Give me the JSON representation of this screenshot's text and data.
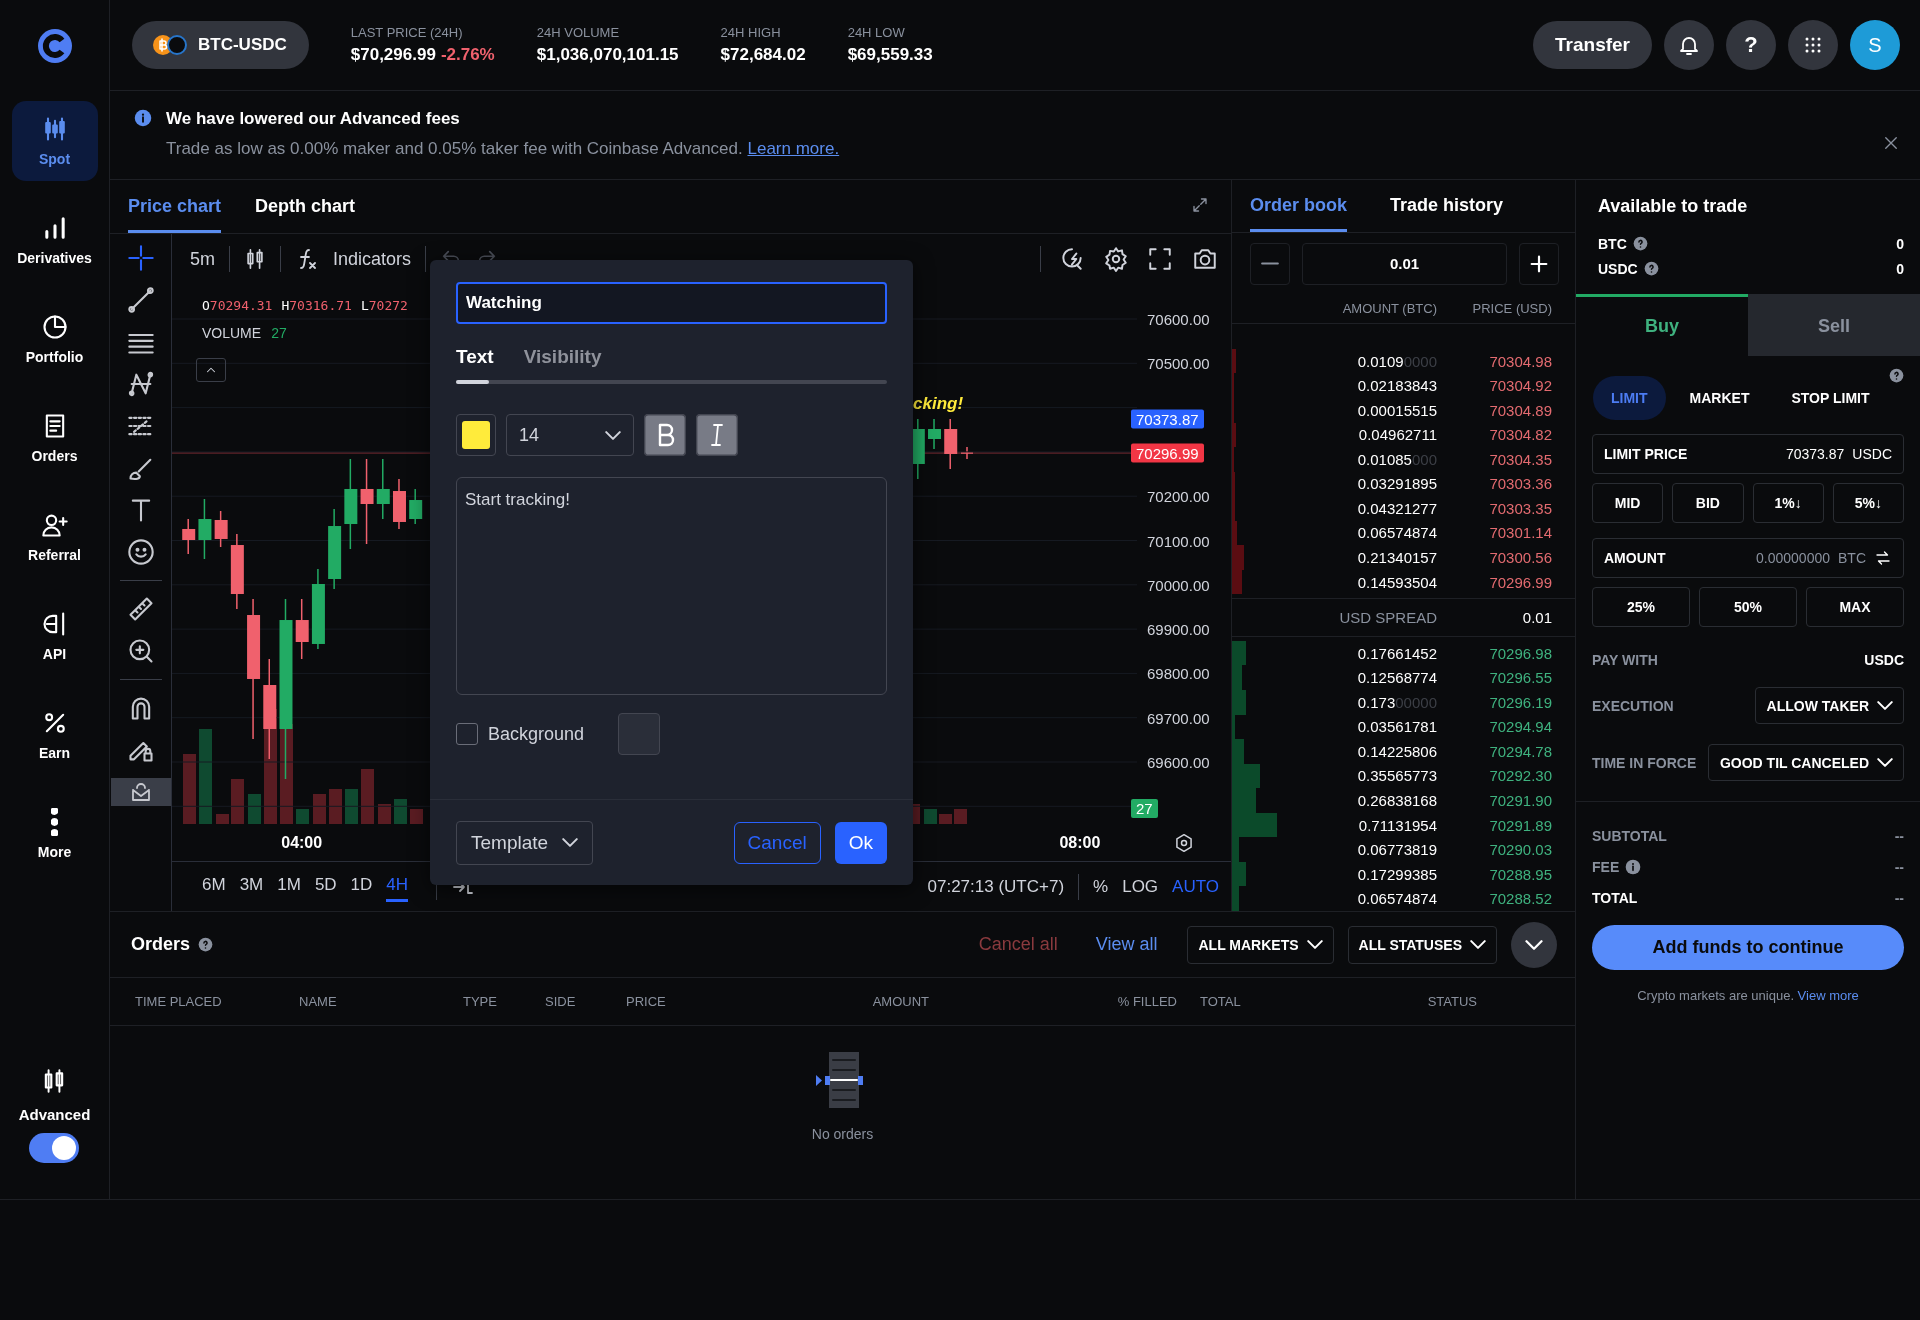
{
  "sidebar": {
    "items": [
      {
        "label": "Spot",
        "selected": true
      },
      {
        "label": "Derivatives",
        "selected": false
      },
      {
        "label": "Portfolio",
        "selected": false
      },
      {
        "label": "Orders",
        "selected": false
      },
      {
        "label": "Referral",
        "selected": false
      },
      {
        "label": "API",
        "selected": false
      },
      {
        "label": "Earn",
        "selected": false
      },
      {
        "label": "More",
        "selected": false
      }
    ],
    "advanced": {
      "label": "Advanced",
      "on": true
    }
  },
  "header": {
    "pair": "BTC-USDC",
    "stats": [
      {
        "label": "LAST PRICE (24H)",
        "value": "$70,296.99",
        "change": "-2.76%"
      },
      {
        "label": "24H VOLUME",
        "value": "$1,036,070,101.15"
      },
      {
        "label": "24H HIGH",
        "value": "$72,684.02"
      },
      {
        "label": "24H LOW",
        "value": "$69,559.33"
      }
    ],
    "transfer": "Transfer",
    "help": "?",
    "avatar": "S"
  },
  "banner": {
    "title": "We have lowered our Advanced fees",
    "text": "Trade as low as 0.00% maker and 0.05% taker fee with Coinbase Advanced.",
    "link": "Learn more."
  },
  "chart": {
    "tabs": [
      {
        "label": "Price chart",
        "selected": true
      },
      {
        "label": "Depth chart",
        "selected": false
      }
    ],
    "interval": "5m",
    "indicators": "Indicators",
    "ohlc": [
      {
        "key": "O",
        "value": "70294.31"
      },
      {
        "key": "H",
        "value": "70316.71"
      },
      {
        "key": "L",
        "value": "70272"
      }
    ],
    "volume_label": "VOLUME",
    "volume_value": "27",
    "annotation": "cking!",
    "price_markers": [
      {
        "label": "70373.87",
        "color": "#2962ff"
      },
      {
        "label": "70296.99",
        "color": "#f23645"
      }
    ],
    "volume_marker": {
      "label": "27",
      "color": "#22ab64"
    },
    "chart_data": {
      "type": "candlestick",
      "x": [
        205,
        210,
        215,
        220,
        225,
        230,
        235,
        240,
        245,
        250,
        255,
        260,
        265,
        270,
        275,
        430,
        435,
        440
      ],
      "ohlc": [
        [
          70126.0,
          70148.5,
          70069.5,
          70101.1
        ],
        [
          70101.1,
          70193.7,
          70058.2,
          70148.5
        ],
        [
          70146.3,
          70166.6,
          70085.3,
          70103.4
        ],
        [
          70089.8,
          70114.7,
          69945.4,
          69979.2
        ],
        [
          69931.8,
          69967.9,
          69651.9,
          69787.4
        ],
        [
          69773.8,
          69832.5,
          69606.8,
          69674.5
        ],
        [
          69674.5,
          69967.9,
          69561.6,
          69920.5
        ],
        [
          69920.5,
          69967.9,
          69832.5,
          69870.9
        ],
        [
          69866.4,
          70035.7,
          69855.1,
          70001.8
        ],
        [
          70013.1,
          70171.1,
          69990.5,
          70132.7
        ],
        [
          70137.2,
          70284.0,
          70080.8,
          70216.3
        ],
        [
          70216.3,
          70284.0,
          70092.1,
          70182.4
        ],
        [
          70182.4,
          70284.0,
          70148.5,
          70216.3
        ],
        [
          70211.7,
          70238.8,
          70126.0,
          70141.8
        ],
        [
          70148.5,
          70216.3,
          70137.2,
          70191.4
        ],
        [
          70272.7,
          70374.3,
          70238.8,
          70351.7
        ],
        [
          70329.1,
          70374.3,
          70306.5,
          70351.7
        ],
        [
          70351.7,
          70374.3,
          70261.4,
          70295.3
        ]
      ],
      "xlim": [
        200,
        497.6
      ],
      "ylim": [
        69600,
        70600
      ],
      "grid": true,
      "yticks": [
        {
          "value": 70600,
          "label": "70600.00"
        },
        {
          "value": 70500,
          "label": "70500.00"
        },
        {
          "value": 70200,
          "label": "70200.00"
        },
        {
          "value": 70100,
          "label": "70100.00"
        },
        {
          "value": 70000,
          "label": "70000.00"
        },
        {
          "value": 69900,
          "label": "69900.00"
        },
        {
          "value": 69800,
          "label": "69800.00"
        },
        {
          "value": 69700,
          "label": "69700.00"
        },
        {
          "value": 69600,
          "label": "69600.00"
        }
      ],
      "xticks": [
        {
          "value": 240,
          "label": "04:00"
        },
        {
          "value": 480,
          "label": "08:00"
        }
      ]
    },
    "ranges": [
      {
        "label": "6M",
        "selected": false
      },
      {
        "label": "3M",
        "selected": false
      },
      {
        "label": "1M",
        "selected": false
      },
      {
        "label": "5D",
        "selected": false
      },
      {
        "label": "1D",
        "selected": false
      },
      {
        "label": "4H",
        "selected": true
      }
    ],
    "clock": "07:27:13 (UTC+7)",
    "scale_options": [
      {
        "label": "%",
        "selected": false
      },
      {
        "label": "LOG",
        "selected": false
      },
      {
        "label": "AUTO",
        "selected": true
      }
    ]
  },
  "dialog": {
    "name_value": "Watching",
    "tabs": [
      {
        "label": "Text",
        "selected": true
      },
      {
        "label": "Visibility",
        "selected": false
      }
    ],
    "style": {
      "color": "#ffeb3b",
      "font_size": "14",
      "bold": true,
      "italic": true
    },
    "text": "Start tracking!",
    "background": {
      "label": "Background",
      "checked": false
    },
    "template": "Template",
    "cancel": "Cancel",
    "ok": "Ok"
  },
  "order_book": {
    "tabs": [
      {
        "label": "Order book",
        "selected": true
      },
      {
        "label": "Trade history",
        "selected": false
      }
    ],
    "step": "0.01",
    "columns": [
      "AMOUNT (BTC)",
      "PRICE (USD)"
    ],
    "asks": [
      {
        "amount": "0.0109",
        "pad": "0000",
        "price": "70304.98"
      },
      {
        "amount": "0.02183843",
        "price": "70304.92"
      },
      {
        "amount": "0.00015515",
        "price": "70304.89"
      },
      {
        "amount": "0.04962711",
        "price": "70304.82"
      },
      {
        "amount": "0.01085",
        "pad": "000",
        "price": "70304.35"
      },
      {
        "amount": "0.03291895",
        "price": "70303.36"
      },
      {
        "amount": "0.04321277",
        "price": "70303.35"
      },
      {
        "amount": "0.06574874",
        "price": "70301.14"
      },
      {
        "amount": "0.21340157",
        "price": "70300.56"
      },
      {
        "amount": "0.14593504",
        "price": "70296.99"
      }
    ],
    "spread_label": "USD SPREAD",
    "spread": "0.01",
    "bids": [
      {
        "amount": "0.17661452",
        "price": "70296.98"
      },
      {
        "amount": "0.12568774",
        "price": "70296.55"
      },
      {
        "amount": "0.173",
        "pad": "00000",
        "price": "70296.19"
      },
      {
        "amount": "0.03561781",
        "price": "70294.94"
      },
      {
        "amount": "0.14225806",
        "price": "70294.78"
      },
      {
        "amount": "0.35565773",
        "price": "70292.30"
      },
      {
        "amount": "0.26838168",
        "price": "70291.90"
      },
      {
        "amount": "0.71131954",
        "price": "70291.89"
      },
      {
        "amount": "0.06773819",
        "price": "70290.03"
      },
      {
        "amount": "0.17299385",
        "price": "70288.95"
      },
      {
        "amount": "0.06574874",
        "price": "70288.52"
      }
    ]
  },
  "trade": {
    "title": "Available to trade",
    "assets": [
      {
        "name": "BTC",
        "value": "0"
      },
      {
        "name": "USDC",
        "value": "0"
      }
    ],
    "sides": [
      {
        "label": "Buy",
        "selected": true
      },
      {
        "label": "Sell",
        "selected": false
      }
    ],
    "order_types": [
      {
        "label": "LIMIT",
        "selected": true
      },
      {
        "label": "MARKET",
        "selected": false
      },
      {
        "label": "STOP LIMIT",
        "selected": false
      }
    ],
    "limit_price": {
      "label": "LIMIT PRICE",
      "value": "70373.87",
      "unit": "USDC"
    },
    "price_presets": [
      "MID",
      "BID",
      "1%↓",
      "5%↓"
    ],
    "amount": {
      "label": "AMOUNT",
      "placeholder": "0.00000000",
      "unit": "BTC"
    },
    "amount_presets": [
      "25%",
      "50%",
      "MAX"
    ],
    "pay_with": {
      "label": "PAY WITH",
      "value": "USDC"
    },
    "execution": {
      "label": "EXECUTION",
      "value": "ALLOW TAKER"
    },
    "time_in_force": {
      "label": "TIME IN FORCE",
      "value": "GOOD TIL CANCELED"
    },
    "summary": [
      {
        "kind": "plain",
        "label": "SUBTOTAL",
        "value": "--"
      },
      {
        "kind": "info",
        "label": "FEE",
        "value": "--"
      },
      {
        "kind": "total",
        "label": "TOTAL",
        "value": "--"
      }
    ],
    "submit": "Add funds to continue",
    "note": "Crypto markets are unique.",
    "note_link": "View more"
  },
  "orders": {
    "title": "Orders",
    "cancel_all": "Cancel all",
    "view_all": "View all",
    "filters": [
      "ALL MARKETS",
      "ALL STATUSES"
    ],
    "columns": [
      "TIME PLACED",
      "NAME",
      "TYPE",
      "SIDE",
      "PRICE",
      "AMOUNT",
      "% FILLED",
      "TOTAL",
      "STATUS"
    ],
    "empty": "No orders"
  }
}
